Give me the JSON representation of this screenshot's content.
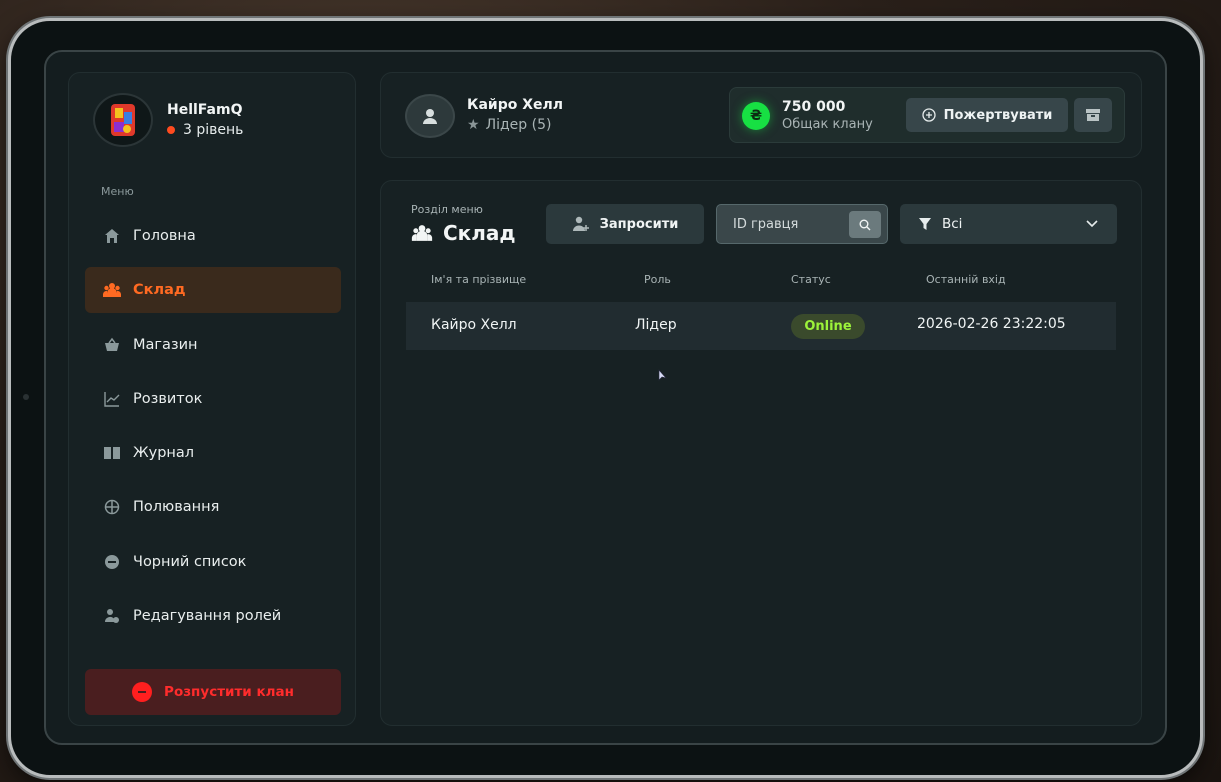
{
  "clan": {
    "name": "HellFamQ",
    "level": "3 рівень"
  },
  "sidebar": {
    "menu_title": "Меню",
    "items": [
      {
        "label": "Головна",
        "icon": "home-icon"
      },
      {
        "label": "Склад",
        "icon": "people-icon",
        "active": true
      },
      {
        "label": "Магазин",
        "icon": "basket-icon"
      },
      {
        "label": "Розвиток",
        "icon": "chart-line-icon"
      },
      {
        "label": "Журнал",
        "icon": "book-icon"
      },
      {
        "label": "Полювання",
        "icon": "crosshair-icon"
      },
      {
        "label": "Чорний список",
        "icon": "block-icon"
      },
      {
        "label": "Редагування ролей",
        "icon": "user-gear-icon"
      }
    ],
    "disband_label": "Розпустити клан"
  },
  "user": {
    "name": "Кайро Хелл",
    "role": "Лідер (5)"
  },
  "treasury": {
    "amount": "750 000",
    "label": "Общак клану",
    "currency_symbol": "₴",
    "donate_label": "Пожертвувати"
  },
  "main": {
    "section_label": "Розділ меню",
    "section_title": "Склад",
    "invite_label": "Запросити",
    "search_placeholder": "ID гравця",
    "filter_value": "Всі",
    "columns": [
      "Ім'я та прізвище",
      "Роль",
      "Статус",
      "Останній вхід"
    ],
    "rows": [
      {
        "name": "Кайро Хелл",
        "role": "Лідер",
        "status": "Online",
        "last_login": "2026-02-26 23:22:05"
      }
    ]
  },
  "colors": {
    "accent": "#ff6a22",
    "online": "#9cf23a",
    "danger": "#ff2c2c",
    "coin": "#17e043"
  }
}
